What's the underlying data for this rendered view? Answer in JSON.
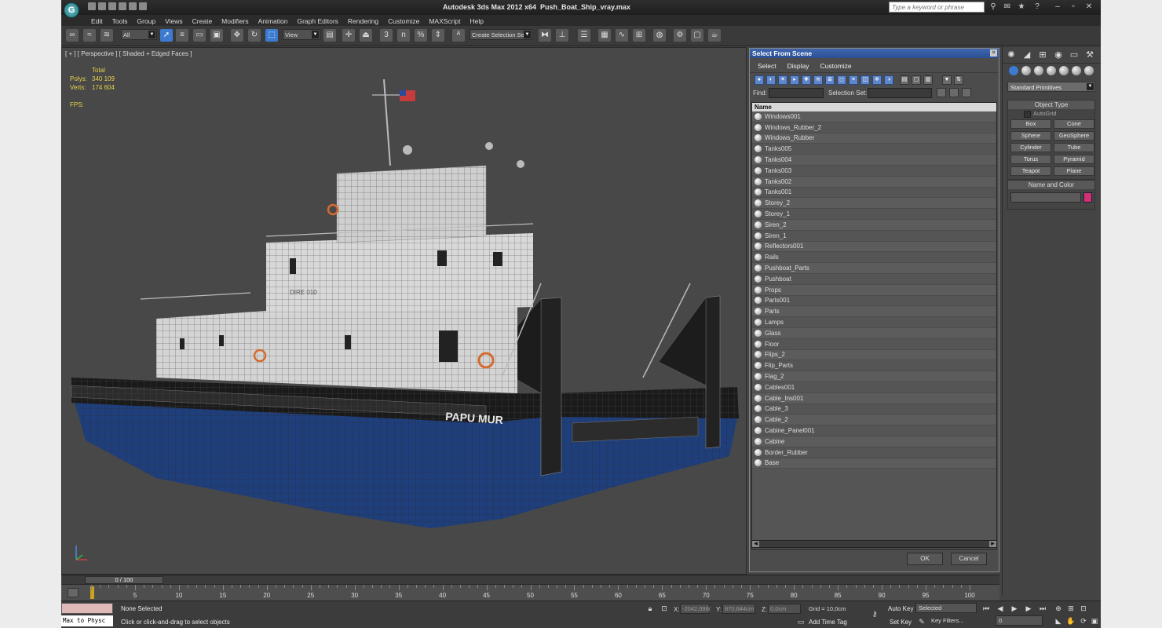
{
  "window": {
    "app_title": "Autodesk 3ds Max  2012 x64",
    "file_name": "Push_Boat_Ship_vray.max",
    "search_placeholder": "Type a keyword or phrase",
    "logo_letter": "G"
  },
  "menu": [
    "Edit",
    "Tools",
    "Group",
    "Views",
    "Create",
    "Modifiers",
    "Animation",
    "Graph Editors",
    "Rendering",
    "Customize",
    "MAXScript",
    "Help"
  ],
  "toolbar": {
    "filter_value": "All",
    "ref_coord_value": "View",
    "selection_set_value": "Create Selection Se",
    "snaps_label": "3",
    "angle_snap_label": "n",
    "percent_snap_label": "%"
  },
  "viewport": {
    "label": "[ + ] [ Perspective ] [ Shaded + Edged Faces ]",
    "stats_header": "Total",
    "polys_label": "Polys:",
    "polys_value": "340 109",
    "verts_label": "Verts:",
    "verts_value": "174 604",
    "fps_label": "FPS:",
    "hull_text": "PAPU MUR",
    "wall_text": "DIRE 010"
  },
  "dialog": {
    "title": "Select From Scene",
    "menu": [
      "Select",
      "Display",
      "Customize"
    ],
    "find_label": "Find:",
    "selection_set_label": "Selection Set:",
    "column_name": "Name",
    "objects": [
      "Windows001",
      "Windows_Rubber_2",
      "Windows_Rubber",
      "Tanks005",
      "Tanks004",
      "Tanks003",
      "Tanks002",
      "Tanks001",
      "Storey_2",
      "Storey_1",
      "Siren_2",
      "Siren_1",
      "Reflectors001",
      "Rails",
      "Pushboat_Parts",
      "Pushboat",
      "Props",
      "Parts001",
      "Parts",
      "Lamps",
      "Glass",
      "Floor",
      "Flips_2",
      "Flip_Parts",
      "Flag_2",
      "Cables001",
      "Cable_Ins001",
      "Cable_3",
      "Cable_2",
      "Cabine_Panel001",
      "Cabine",
      "Border_Rubber",
      "Base"
    ],
    "ok_label": "OK",
    "cancel_label": "Cancel"
  },
  "command_panel": {
    "category_value": "Standard Primitives",
    "object_type_title": "Object Type",
    "autogrid_label": "AutoGrid",
    "buttons": [
      "Box",
      "Cone",
      "Sphere",
      "GeoSphere",
      "Cylinder",
      "Tube",
      "Torus",
      "Pyramid",
      "Teapot",
      "Plane"
    ],
    "name_color_title": "Name and Color",
    "color": "#d0307a"
  },
  "timeline": {
    "frame_label": "0 / 100",
    "ticks": [
      "5",
      "10",
      "15",
      "20",
      "25",
      "30",
      "35",
      "40",
      "45",
      "50",
      "55",
      "60",
      "65",
      "70",
      "75",
      "80",
      "85",
      "90",
      "95",
      "100"
    ]
  },
  "status": {
    "selection": "None Selected",
    "prompt": "Click or click-and-drag to select objects",
    "maxscript_value": "Max to Physc",
    "x_label": "X:",
    "x_value": "-2042,098(",
    "y_label": "Y:",
    "y_value": "870,644cm",
    "z_label": "Z:",
    "z_value": "0,0cm",
    "grid": "Grid = 10,0cm",
    "add_time_tag": "Add Time Tag",
    "auto_key": "Auto Key",
    "set_key": "Set Key",
    "key_mode_value": "Selected",
    "key_filters": "Key Filters...",
    "frame_value": "0"
  }
}
